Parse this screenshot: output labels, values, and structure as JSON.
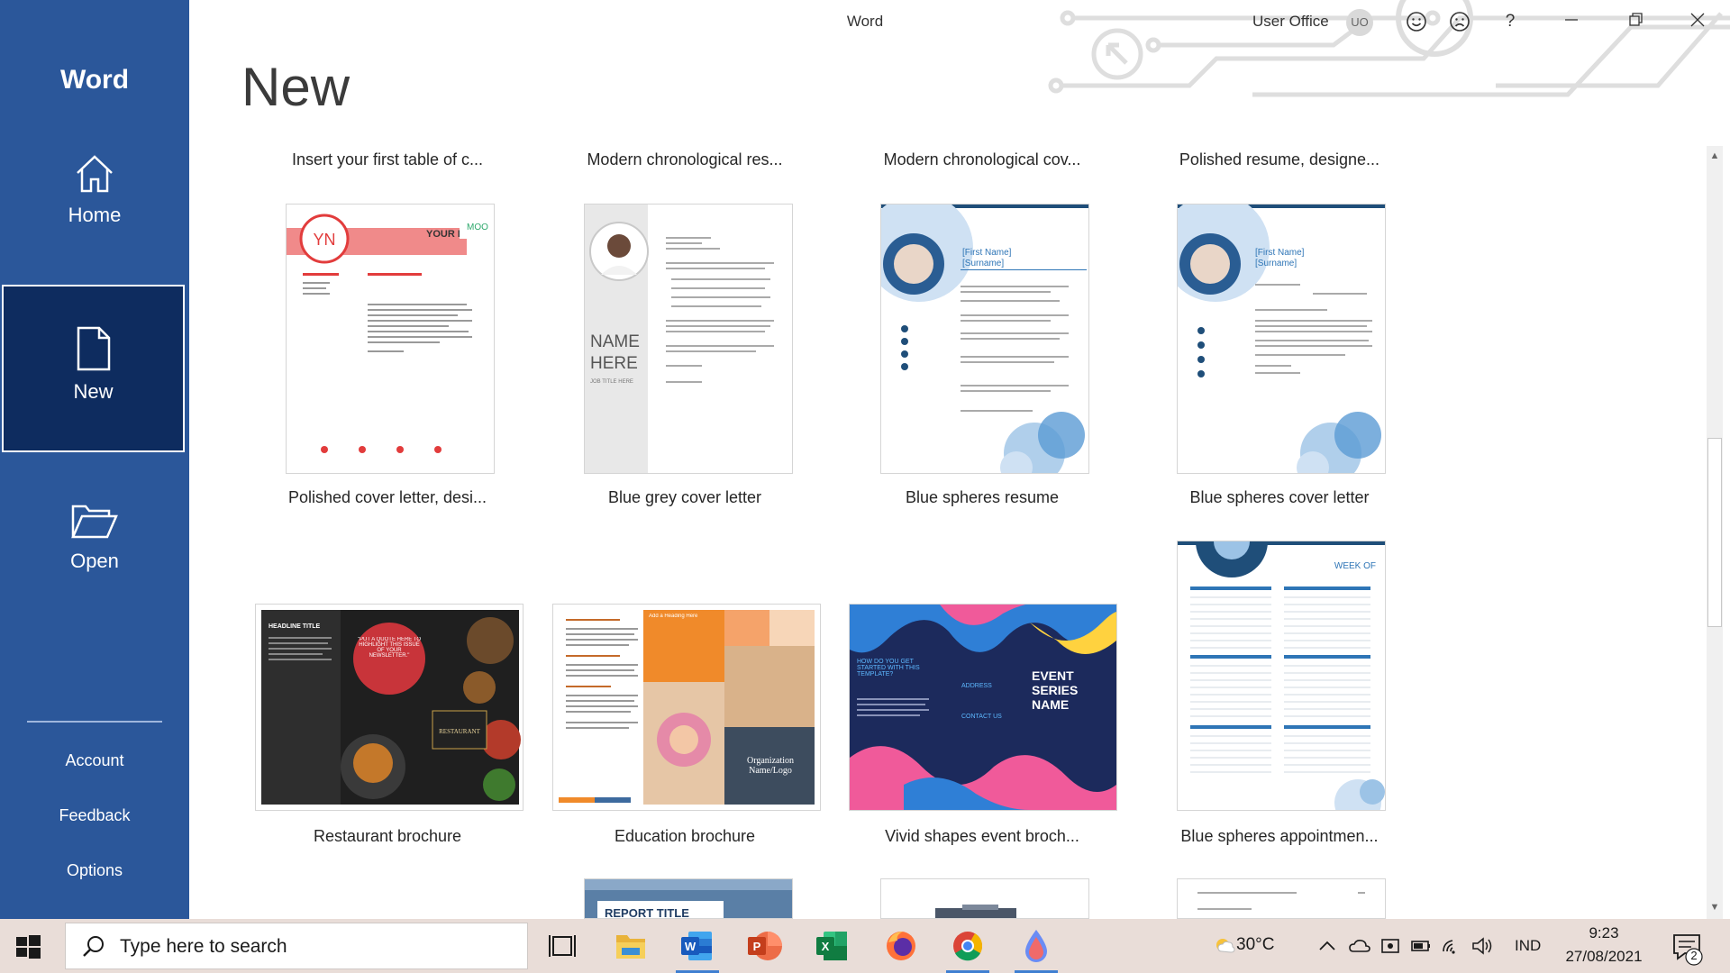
{
  "app": {
    "name": "Word",
    "window_title": "Word"
  },
  "user": {
    "name": "User Office",
    "initials": "UO"
  },
  "sidebar": {
    "home": "Home",
    "new": "New",
    "open": "Open",
    "account": "Account",
    "feedback": "Feedback",
    "options": "Options"
  },
  "titlebar": {
    "help": "?"
  },
  "main": {
    "title": "New",
    "top_captions": [
      "Insert your first table of c...",
      "Modern chronological res...",
      "Modern chronological cov...",
      "Polished resume, designe..."
    ],
    "row1": [
      {
        "label": "Polished cover letter, desi...",
        "initials": "YN",
        "name": "YOUR N",
        "brand": "MOO"
      },
      {
        "label": "Blue grey cover letter",
        "name_line1": "NAME",
        "name_line2": "HERE",
        "subtitle": "JOB TITLE HERE"
      },
      {
        "label": "Blue spheres resume",
        "name_line1": "[First Name]",
        "name_line2": "[Surname]"
      },
      {
        "label": "Blue spheres cover letter",
        "name_line1": "[First Name]",
        "name_line2": "[Surname]"
      }
    ],
    "row2": [
      {
        "label": "Restaurant brochure",
        "heading": "HEADLINE TITLE",
        "quote": "\"PUT A QUOTE HERE TO HIGHLIGHT THIS ISSUE OF YOUR NEWSLETTER.\"",
        "badge": "RESTAURANT"
      },
      {
        "label": "Education brochure",
        "org": "Organization Name/Logo",
        "heading": "Add a Heading Here"
      },
      {
        "label": "Vivid shapes event broch...",
        "question": "HOW DO YOU GET STARTED WITH THIS TEMPLATE?",
        "event_line1": "EVENT",
        "event_line2": "SERIES",
        "event_line3": "NAME",
        "address": "ADDRESS",
        "contact": "CONTACT US"
      },
      {
        "label": "Blue spheres appointmen...",
        "week": "WEEK OF"
      }
    ],
    "row3": [
      {
        "title": "REPORT TITLE"
      }
    ]
  },
  "taskbar": {
    "search_placeholder": "Type here to search",
    "weather": "30°C",
    "language": "IND",
    "time": "9:23",
    "date": "27/08/2021",
    "notifications": "2"
  },
  "colors": {
    "accent": "#2b579a",
    "selected": "#0e2c5f",
    "taskbar": "#e9ddd8"
  }
}
